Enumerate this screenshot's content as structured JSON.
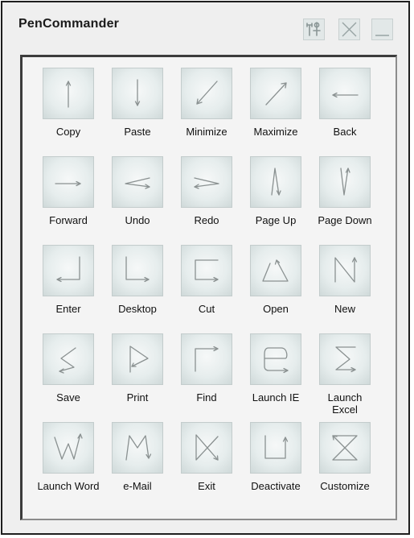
{
  "window": {
    "title": "PenCommander"
  },
  "titlebar": {
    "buttons": [
      {
        "icon": "tools-icon"
      },
      {
        "icon": "close-icon"
      },
      {
        "icon": "minimize-icon"
      }
    ]
  },
  "gestures": [
    {
      "label": "Copy",
      "icon": "arrow-up-icon"
    },
    {
      "label": "Paste",
      "icon": "arrow-down-icon"
    },
    {
      "label": "Minimize",
      "icon": "arrow-down-left-icon"
    },
    {
      "label": "Maximize",
      "icon": "arrow-up-right-icon"
    },
    {
      "label": "Back",
      "icon": "arrow-left-icon"
    },
    {
      "label": "Forward",
      "icon": "arrow-right-icon"
    },
    {
      "label": "Undo",
      "icon": "gesture-undo-icon"
    },
    {
      "label": "Redo",
      "icon": "gesture-redo-icon"
    },
    {
      "label": "Page Up",
      "icon": "gesture-page-up-icon"
    },
    {
      "label": "Page Down",
      "icon": "gesture-page-down-icon"
    },
    {
      "label": "Enter",
      "icon": "gesture-enter-icon"
    },
    {
      "label": "Desktop",
      "icon": "gesture-desktop-icon"
    },
    {
      "label": "Cut",
      "icon": "gesture-cut-icon"
    },
    {
      "label": "Open",
      "icon": "gesture-open-icon"
    },
    {
      "label": "New",
      "icon": "gesture-new-icon"
    },
    {
      "label": "Save",
      "icon": "gesture-save-icon"
    },
    {
      "label": "Print",
      "icon": "gesture-print-icon"
    },
    {
      "label": "Find",
      "icon": "gesture-find-icon"
    },
    {
      "label": "Launch IE",
      "icon": "gesture-launch-ie-icon"
    },
    {
      "label": "Launch Excel",
      "icon": "gesture-launch-excel-icon"
    },
    {
      "label": "Launch Word",
      "icon": "gesture-launch-word-icon"
    },
    {
      "label": "e-Mail",
      "icon": "gesture-email-icon"
    },
    {
      "label": "Exit",
      "icon": "gesture-exit-icon"
    },
    {
      "label": "Deactivate",
      "icon": "gesture-deactivate-icon"
    },
    {
      "label": "Customize",
      "icon": "gesture-customize-icon"
    }
  ]
}
